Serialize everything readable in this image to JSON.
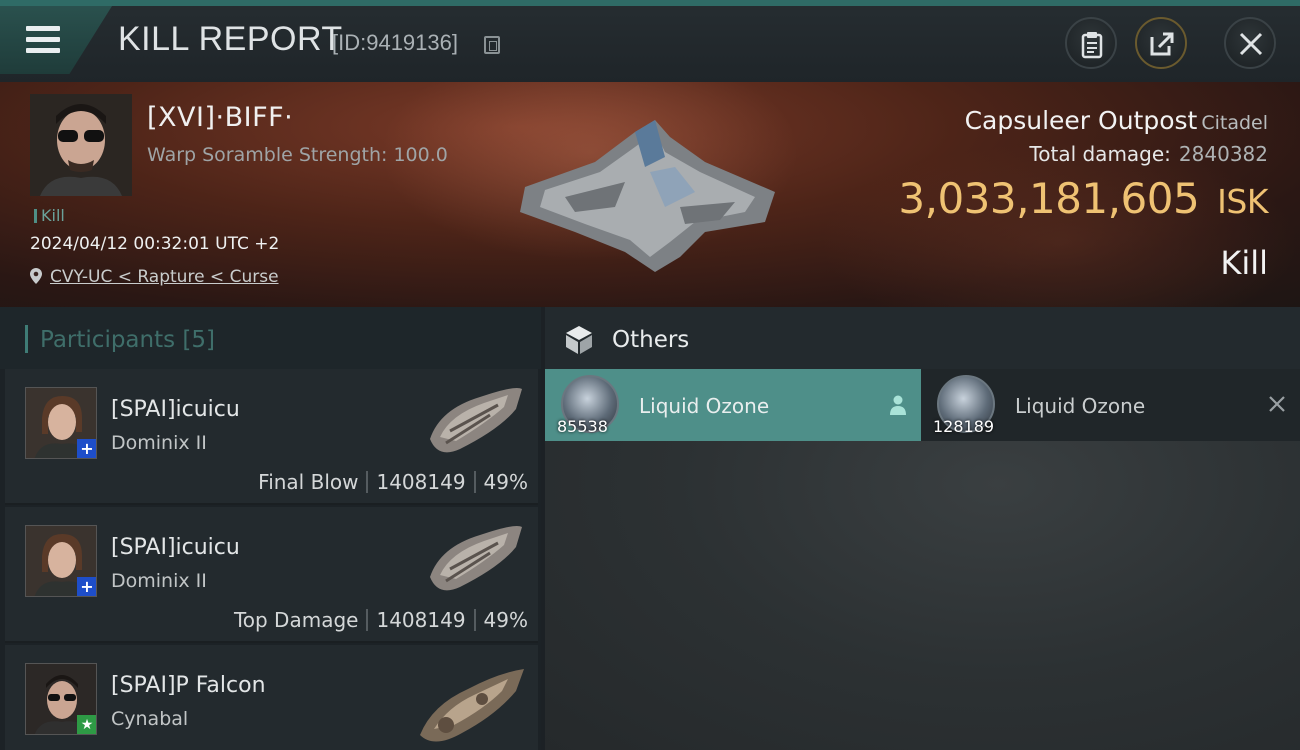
{
  "header": {
    "title": "KILL REPORT",
    "report_id": "[ID:9419136]"
  },
  "victim": {
    "name": "[XVI]·BIFF·",
    "subtitle": "Warp Soramble Strength: 100.0",
    "tag": "Kill",
    "time": "2024/04/12 00:32:01 UTC +2",
    "location": "CVY-UC < Rapture < Curse",
    "target_name": "Capsuleer Outpost",
    "target_class": "Citadel",
    "total_damage_label": "Total damage:",
    "total_damage_value": "2840382",
    "isk_value": "3,033,181,605",
    "isk_unit": "ISK",
    "result": "Kill"
  },
  "participants": {
    "title": "Participants",
    "count": "[5]",
    "rows": [
      {
        "name": "[SPAI]icuicu",
        "ship": "Dominix II",
        "role": "Final Blow",
        "damage": "1408149",
        "percent": "49%",
        "badge": "+"
      },
      {
        "name": "[SPAI]icuicu",
        "ship": "Dominix II",
        "role": "Top Damage",
        "damage": "1408149",
        "percent": "49%",
        "badge": "+"
      },
      {
        "name": "[SPAI]P Falcon",
        "ship": "Cynabal",
        "badge": "★"
      }
    ]
  },
  "others": {
    "title": "Others",
    "items": [
      {
        "name": "Liquid Ozone",
        "qty": "85538"
      },
      {
        "name": "Liquid Ozone",
        "qty": "128189"
      }
    ]
  },
  "colors": {
    "accent": "#4e8f89",
    "isk": "#efc273",
    "badge_blue": "#1e4ec9",
    "badge_green": "#2e9a45"
  },
  "icons": [
    "menu-icon",
    "copy-icon",
    "clipboard-icon",
    "share-icon",
    "close-icon",
    "location-pin-icon",
    "cube-icon",
    "person-icon",
    "x-icon"
  ]
}
